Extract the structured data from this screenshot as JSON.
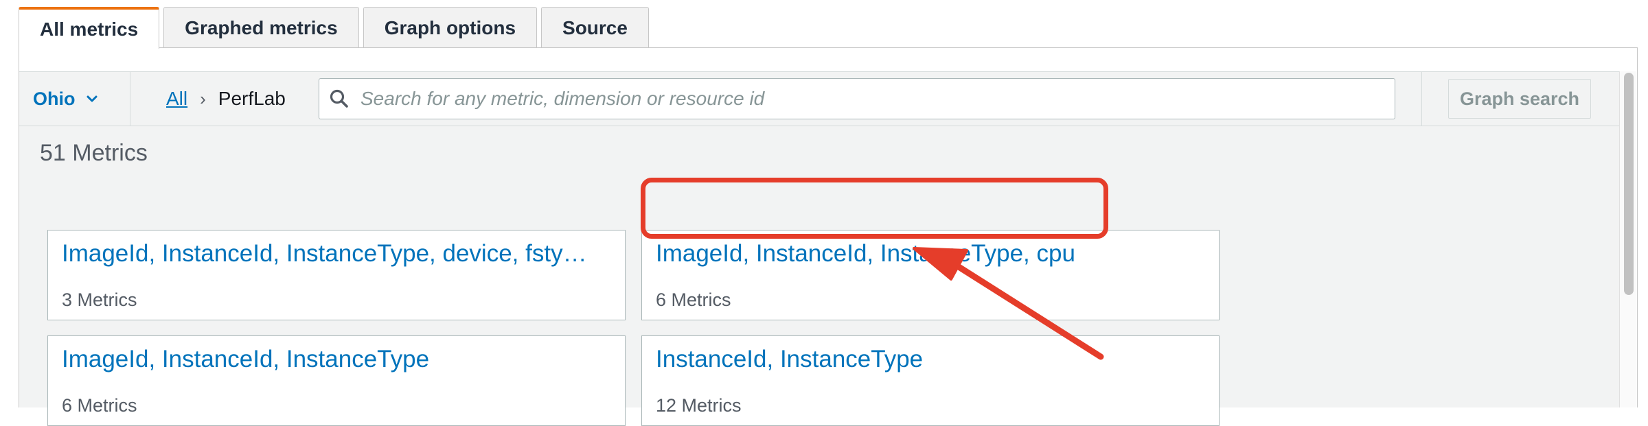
{
  "tabs": [
    {
      "label": "All metrics",
      "active": true
    },
    {
      "label": "Graphed metrics",
      "active": false
    },
    {
      "label": "Graph options",
      "active": false
    },
    {
      "label": "Source",
      "active": false
    }
  ],
  "toolbar": {
    "region": "Ohio",
    "breadcrumb": {
      "all": "All",
      "namespace": "PerfLab"
    },
    "search_placeholder": "Search for any metric, dimension or resource id",
    "search_value": "",
    "graph_search_label": "Graph search"
  },
  "content": {
    "metrics_count": "51 Metrics",
    "cards": [
      {
        "title": "ImageId, InstanceId, InstanceType, device, fsty…",
        "count": "3 Metrics"
      },
      {
        "title": "ImageId, InstanceId, InstanceType, cpu",
        "count": "6 Metrics"
      },
      {
        "title": "ImageId, InstanceId, InstanceType",
        "count": "6 Metrics"
      },
      {
        "title": "InstanceId, InstanceType",
        "count": "12 Metrics"
      }
    ]
  },
  "annotation": {
    "highlighted_card": "ImageId, InstanceId, InstanceType, cpu",
    "color": "#e53d2a"
  },
  "colors": {
    "accent_tab": "#ec7211",
    "link": "#0073bb",
    "annotation": "#e53d2a"
  }
}
